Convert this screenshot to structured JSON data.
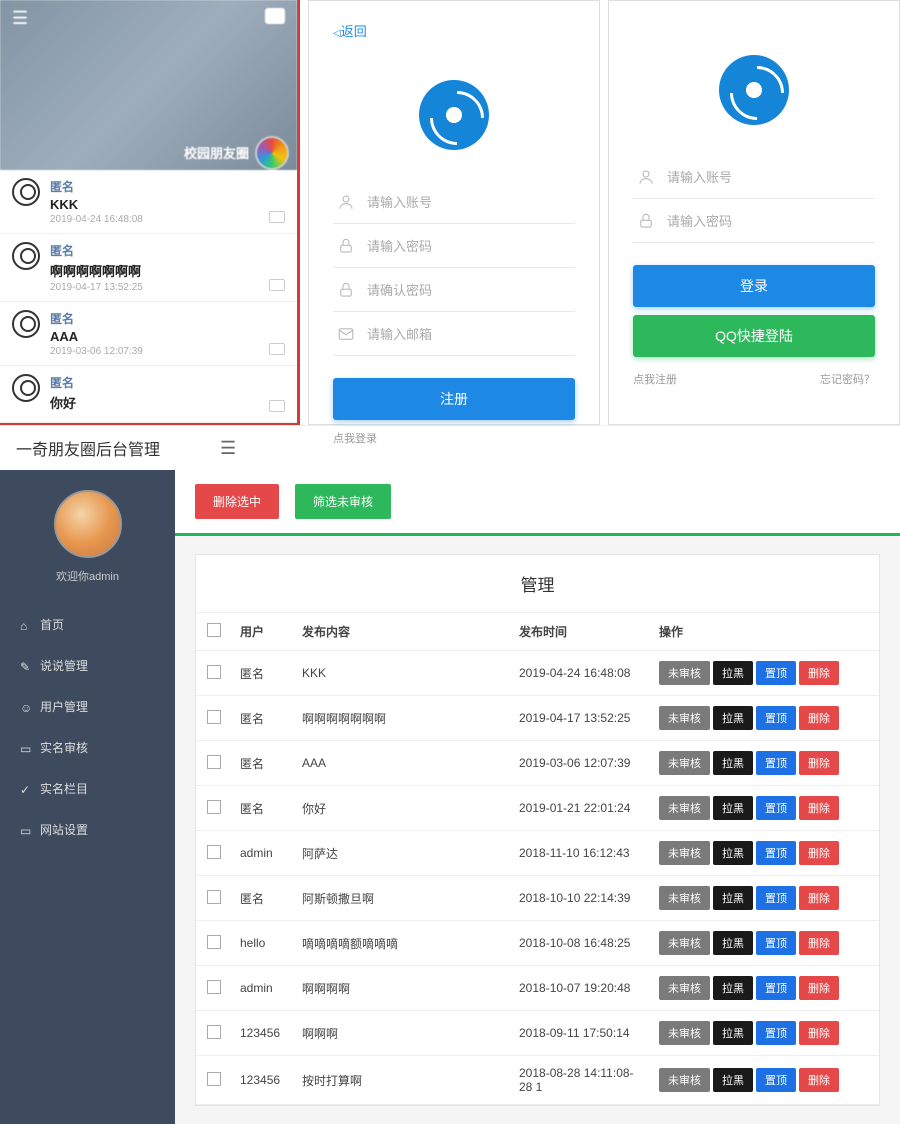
{
  "panel1": {
    "title": "校园朋友圈",
    "items": [
      {
        "name": "匿名",
        "text": "KKK",
        "date": "2019-04-24 16:48:08"
      },
      {
        "name": "匿名",
        "text": "啊啊啊啊啊啊啊",
        "date": "2019-04-17 13:52:25"
      },
      {
        "name": "匿名",
        "text": "AAA",
        "date": "2019-03-06 12:07:39"
      },
      {
        "name": "匿名",
        "text": "你好",
        "date": ""
      }
    ]
  },
  "register": {
    "back": "返回",
    "account": "请输入账号",
    "password": "请输入密码",
    "confirm": "请确认密码",
    "email": "请输入邮箱",
    "submit": "注册",
    "login_link": "点我登录"
  },
  "login": {
    "account": "请输入账号",
    "password": "请输入密码",
    "submit": "登录",
    "qq": "QQ快捷登陆",
    "register_link": "点我注册",
    "forgot": "忘记密码？"
  },
  "admin": {
    "title": "一奇朋友圈后台管理",
    "welcome": "欢迎你admin",
    "menu": [
      "首页",
      "说说管理",
      "用户管理",
      "实名审核",
      "实名栏目",
      "网站设置"
    ],
    "actions": {
      "delete_selected": "删除选中",
      "filter": "筛选未审核"
    },
    "table": {
      "title": "管理",
      "headers": {
        "user": "用户",
        "content": "发布内容",
        "time": "发布时间",
        "ops": "操作"
      },
      "op_labels": {
        "unaudited": "未审核",
        "blacklist": "拉黑",
        "pin": "置顶",
        "delete": "删除"
      },
      "rows": [
        {
          "user": "匿名",
          "content": "KKK",
          "time": "2019-04-24 16:48:08"
        },
        {
          "user": "匿名",
          "content": "啊啊啊啊啊啊啊",
          "time": "2019-04-17 13:52:25"
        },
        {
          "user": "匿名",
          "content": "AAA",
          "time": "2019-03-06 12:07:39"
        },
        {
          "user": "匿名",
          "content": "你好",
          "time": "2019-01-21 22:01:24"
        },
        {
          "user": "admin",
          "content": "阿萨达",
          "time": "2018-11-10 16:12:43"
        },
        {
          "user": "匿名",
          "content": "阿斯顿撒旦啊",
          "time": "2018-10-10 22:14:39"
        },
        {
          "user": "hello",
          "content": "嘀嘀嘀嘀额嘀嘀嘀",
          "time": "2018-10-08 16:48:25"
        },
        {
          "user": "admin",
          "content": "啊啊啊啊",
          "time": "2018-10-07 19:20:48"
        },
        {
          "user": "123456",
          "content": "啊啊啊",
          "time": "2018-09-11 17:50:14"
        },
        {
          "user": "123456",
          "content": "按时打算啊",
          "time": "2018-08-28 14:11:08-28 1"
        }
      ]
    }
  }
}
